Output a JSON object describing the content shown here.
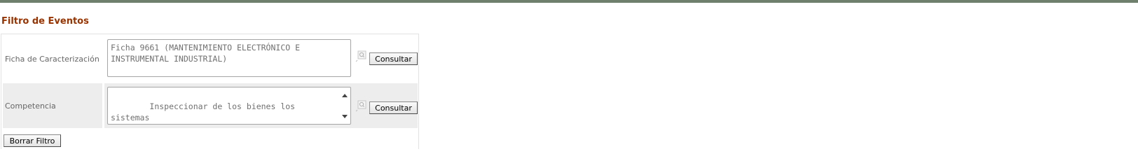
{
  "page": {
    "title": "Filtro de Eventos"
  },
  "filters": {
    "ficha": {
      "label": "Ficha de Caracterización",
      "value": "Ficha 9661 (MANTENIMIENTO ELECTRÓNICO E\nINSTRUMENTAL INDUSTRIAL)",
      "button_label": "Consultar",
      "icon": "magnifier-icon"
    },
    "competencia": {
      "label": "Competencia",
      "value": "Inspeccionar de los bienes los sistemas\nelectrónicos e instrumental industrial\ncomprobando su estado actual con",
      "button_label": "Consultar",
      "icon": "magnifier-icon"
    }
  },
  "actions": {
    "clear_label": "Borrar Filtro"
  },
  "colors": {
    "top_bar": "#6f806c",
    "title": "#993300",
    "alt_row": "#ededed"
  }
}
